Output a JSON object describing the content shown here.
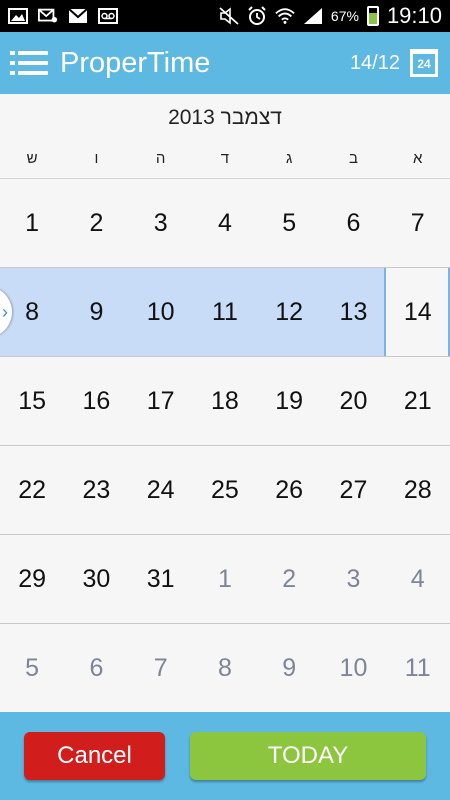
{
  "status_bar": {
    "battery_percent": "67%",
    "time": "19:10",
    "left_icons": [
      "image-icon",
      "mail-settings-icon",
      "gmail-icon",
      "voicemail-icon"
    ],
    "right_icons": [
      "mute-icon",
      "alarm-icon",
      "wifi-icon",
      "signal-icon"
    ]
  },
  "app_bar": {
    "title": "ProperTime",
    "current_date": "14/12",
    "calendar_icon_number": "24"
  },
  "calendar": {
    "month_title": "דצמבר 2013",
    "weekday_headers": [
      "א",
      "ב",
      "ג",
      "ד",
      "ה",
      "ו",
      "ש"
    ],
    "weeks": [
      {
        "days": [
          {
            "n": "1",
            "other": false
          },
          {
            "n": "2",
            "other": false
          },
          {
            "n": "3",
            "other": false
          },
          {
            "n": "4",
            "other": false
          },
          {
            "n": "5",
            "other": false
          },
          {
            "n": "6",
            "other": false
          },
          {
            "n": "7",
            "other": false
          }
        ]
      },
      {
        "days": [
          {
            "n": "8",
            "other": false
          },
          {
            "n": "9",
            "other": false
          },
          {
            "n": "10",
            "other": false
          },
          {
            "n": "11",
            "other": false
          },
          {
            "n": "12",
            "other": false
          },
          {
            "n": "13",
            "other": false
          },
          {
            "n": "14",
            "other": false
          }
        ],
        "selected": true
      },
      {
        "days": [
          {
            "n": "15",
            "other": false
          },
          {
            "n": "16",
            "other": false
          },
          {
            "n": "17",
            "other": false
          },
          {
            "n": "18",
            "other": false
          },
          {
            "n": "19",
            "other": false
          },
          {
            "n": "20",
            "other": false
          },
          {
            "n": "21",
            "other": false
          }
        ]
      },
      {
        "days": [
          {
            "n": "22",
            "other": false
          },
          {
            "n": "23",
            "other": false
          },
          {
            "n": "24",
            "other": false
          },
          {
            "n": "25",
            "other": false
          },
          {
            "n": "26",
            "other": false
          },
          {
            "n": "27",
            "other": false
          },
          {
            "n": "28",
            "other": false
          }
        ]
      },
      {
        "days": [
          {
            "n": "29",
            "other": false
          },
          {
            "n": "30",
            "other": false
          },
          {
            "n": "31",
            "other": false
          },
          {
            "n": "1",
            "other": true
          },
          {
            "n": "2",
            "other": true
          },
          {
            "n": "3",
            "other": true
          },
          {
            "n": "4",
            "other": true
          }
        ]
      },
      {
        "days": [
          {
            "n": "5",
            "other": true
          },
          {
            "n": "6",
            "other": true
          },
          {
            "n": "7",
            "other": true
          },
          {
            "n": "8",
            "other": true
          },
          {
            "n": "9",
            "other": true
          },
          {
            "n": "10",
            "other": true
          },
          {
            "n": "11",
            "other": true
          }
        ]
      }
    ]
  },
  "buttons": {
    "cancel_label": "Cancel",
    "today_label": "TODAY"
  },
  "colors": {
    "accent": "#5db8e2",
    "selection": "#c8dcf8",
    "cancel": "#d21d1d",
    "today": "#8cc63f"
  }
}
